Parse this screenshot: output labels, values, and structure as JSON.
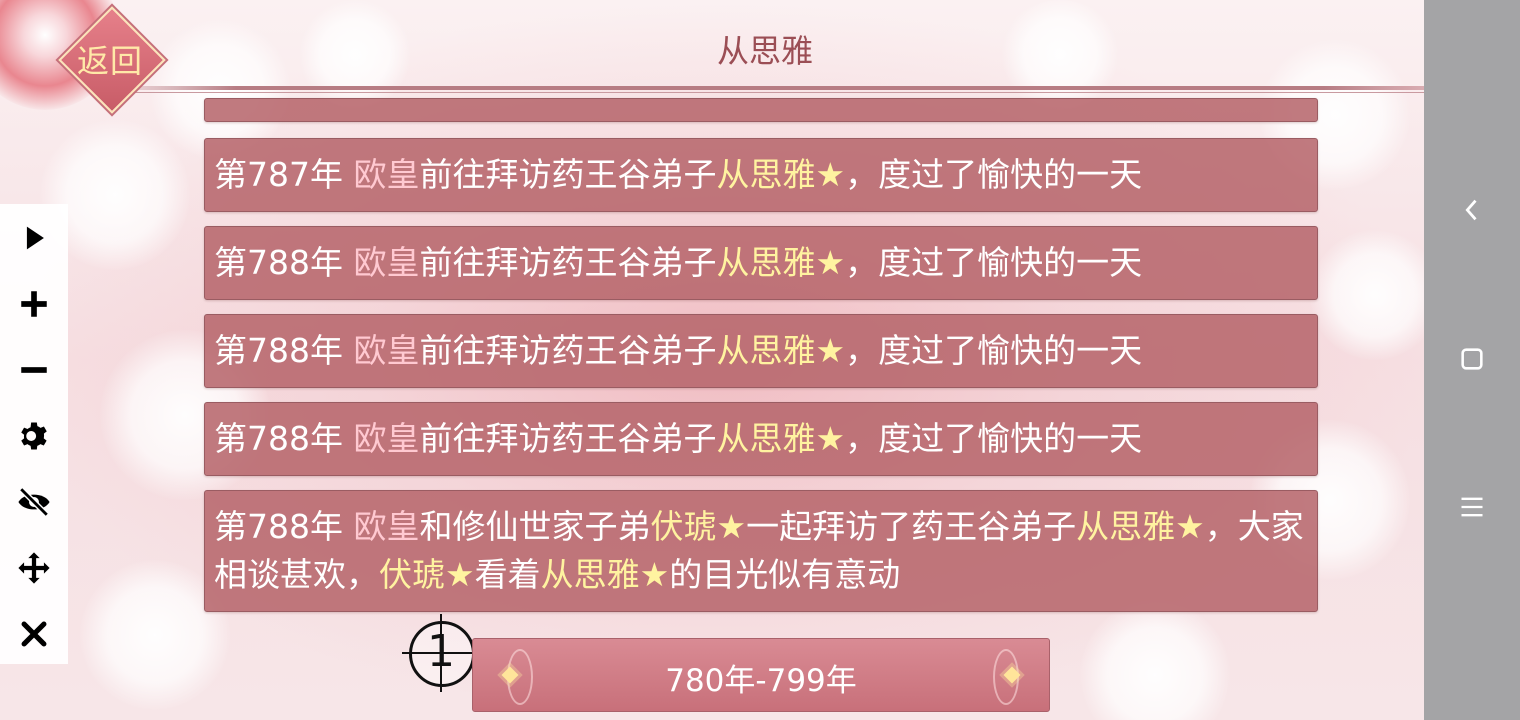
{
  "header": {
    "back_label": "返回",
    "title": "从思雅"
  },
  "toolbar": {
    "items": [
      {
        "icon": "play-icon"
      },
      {
        "icon": "plus-icon"
      },
      {
        "icon": "minus-icon"
      },
      {
        "icon": "gear-icon"
      },
      {
        "icon": "eye-off-icon"
      },
      {
        "icon": "move-icon"
      },
      {
        "icon": "close-icon"
      }
    ]
  },
  "log": {
    "entries": [
      {
        "year": "第787年",
        "actor": "欧皇",
        "action": "前往拜访药王谷弟子",
        "target": "从思雅★",
        "rest": "，度过了愉快的一天"
      },
      {
        "year": "第788年",
        "actor": "欧皇",
        "action": "前往拜访药王谷弟子",
        "target": "从思雅★",
        "rest": "，度过了愉快的一天"
      },
      {
        "year": "第788年",
        "actor": "欧皇",
        "action": "前往拜访药王谷弟子",
        "target": "从思雅★",
        "rest": "，度过了愉快的一天"
      },
      {
        "year": "第788年",
        "actor": "欧皇",
        "action": "前往拜访药王谷弟子",
        "target": "从思雅★",
        "rest": "，度过了愉快的一天"
      },
      {
        "year": "第788年",
        "actor": "欧皇",
        "t1": "和修仙世家子弟",
        "n1": "伏琥★",
        "t2": "一起拜访了药王谷弟子",
        "n2": "从思雅★",
        "t3": "，大家相谈甚欢，",
        "n3": "伏琥★",
        "t4": "看着",
        "n4": "从思雅★",
        "t5": "的目光似有意动"
      }
    ]
  },
  "pager": {
    "range_label": "780年-799年",
    "badge_number": "1"
  },
  "system_nav": {
    "buttons": [
      "back-icon",
      "home-icon",
      "menu-icon"
    ]
  },
  "colors": {
    "entry_bg": "#b6646a",
    "highlight_name": "#fff3a0",
    "actor_name": "#ffc9d1",
    "title": "#9b4e55",
    "nav_bar": "#a4a4a6"
  }
}
